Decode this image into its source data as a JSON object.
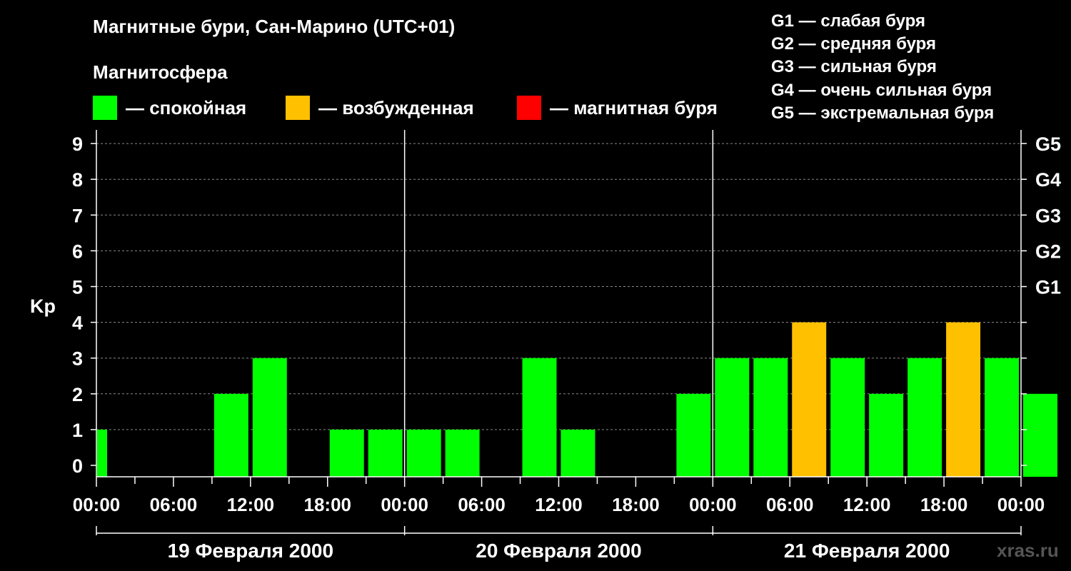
{
  "header": {
    "title": "Магнитные бури, Сан-Марино (UTC+01)",
    "subtitle": "Магнитосфера"
  },
  "legend": [
    {
      "label": "— спокойная",
      "color": "#00ff00"
    },
    {
      "label": "— возбужденная",
      "color": "#ffc000"
    },
    {
      "label": "— магнитная буря",
      "color": "#ff0000"
    }
  ],
  "g_legend": [
    "G1 — слабая буря",
    "G2 — средняя буря",
    "G3 — сильная буря",
    "G4 — очень сильная буря",
    "G5 — экстремальная буря"
  ],
  "watermark": "xras.ru",
  "chart_data": {
    "type": "bar",
    "ylabel": "Kp",
    "xlabel": "",
    "ylim": [
      0,
      9
    ],
    "yticks": [
      0,
      1,
      2,
      3,
      4,
      5,
      6,
      7,
      8,
      9
    ],
    "g_levels": [
      {
        "label": "G1",
        "kp": 5
      },
      {
        "label": "G2",
        "kp": 6
      },
      {
        "label": "G3",
        "kp": 7
      },
      {
        "label": "G4",
        "kp": 8
      },
      {
        "label": "G5",
        "kp": 9
      }
    ],
    "x_tick_labels": [
      "00:00",
      "06:00",
      "12:00",
      "18:00",
      "00:00",
      "06:00",
      "12:00",
      "18:00",
      "00:00",
      "06:00",
      "12:00",
      "18:00",
      "00:00"
    ],
    "days": [
      "19 Февраля 2000",
      "20 Февраля 2000",
      "21 Февраля 2000"
    ],
    "bar_hours": [
      0,
      9,
      12,
      18,
      21,
      24,
      27,
      33,
      36,
      45,
      48,
      51,
      54,
      57,
      60,
      63,
      66,
      69,
      72
    ],
    "values": [
      1,
      2,
      3,
      1,
      1,
      1,
      1,
      3,
      1,
      2,
      3,
      3,
      4,
      3,
      2,
      3,
      4,
      3,
      2
    ],
    "colors": {
      "quiet": "#00ff00",
      "active": "#ffc000",
      "storm": "#ff0000"
    },
    "grid": true
  }
}
